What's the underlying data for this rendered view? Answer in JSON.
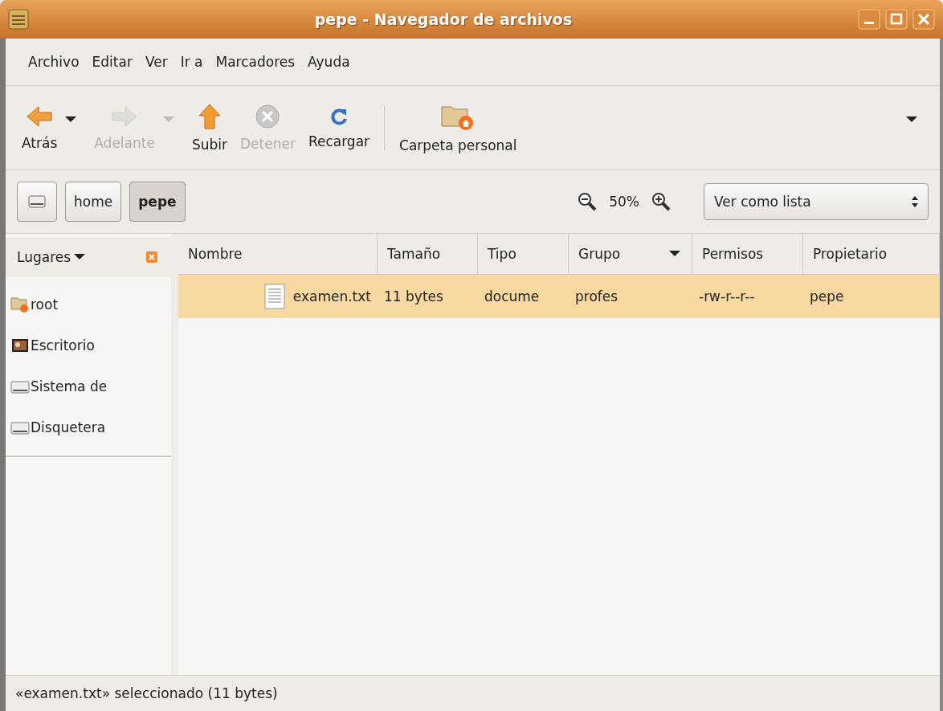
{
  "window": {
    "title": "pepe - Navegador de archivos"
  },
  "menu": [
    "Archivo",
    "Editar",
    "Ver",
    "Ir a",
    "Marcadores",
    "Ayuda"
  ],
  "toolbar": [
    {
      "label": "Atrás",
      "disabled": false,
      "has_menu": true
    },
    {
      "label": "Adelante",
      "disabled": true,
      "has_menu": true
    },
    {
      "label": "Subir",
      "disabled": false,
      "has_menu": false
    },
    {
      "label": "Detener",
      "disabled": true,
      "has_menu": false
    },
    {
      "label": "Recargar",
      "disabled": false,
      "has_menu": false
    },
    {
      "label": "Carpeta personal",
      "disabled": false,
      "has_menu": false
    }
  ],
  "path": [
    {
      "kind": "drive",
      "selected": false
    },
    {
      "label": "home",
      "kind": "folder",
      "selected": false
    },
    {
      "label": "pepe",
      "kind": "folder",
      "selected": true
    }
  ],
  "zoom": "50%",
  "view": "Ver como lista",
  "sidebar": {
    "title": "Lugares",
    "items": [
      "root",
      "Escritorio",
      "Sistema de",
      "Disquetera"
    ]
  },
  "table": {
    "columns": [
      "Nombre",
      "Tamaño",
      "Tipo",
      "Grupo",
      "Permisos",
      "Propietario"
    ],
    "rows": [
      {
        "cells": [
          "examen.txt",
          "11 bytes",
          "docume",
          "profes",
          "-rw-r--r--",
          "pepe"
        ],
        "selected": true
      }
    ]
  },
  "status_bar": "«examen.txt» seleccionado (11 bytes)"
}
